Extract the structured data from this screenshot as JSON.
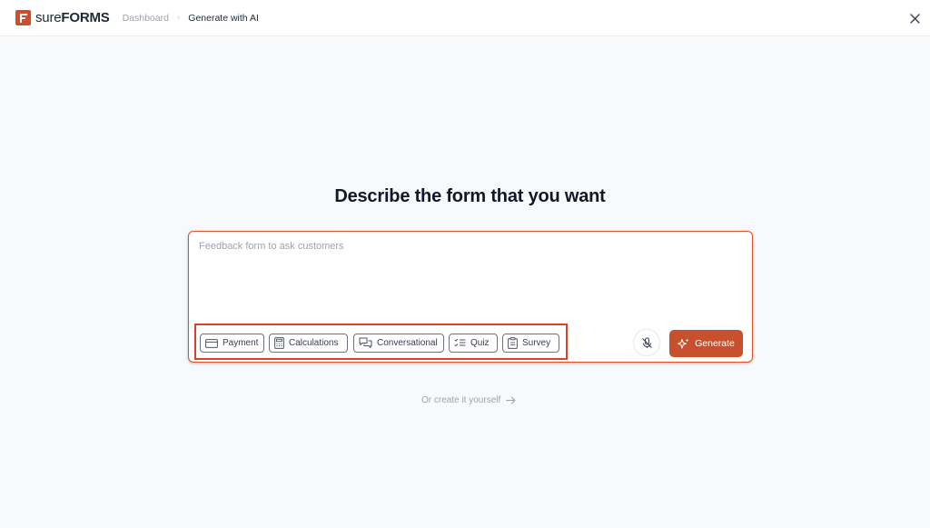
{
  "brand": {
    "name_prefix": "sure",
    "name_suffix": "FORMS",
    "accent_color": "#cf4d2a"
  },
  "breadcrumb": {
    "items": [
      "Dashboard",
      "Generate with AI"
    ],
    "separator": "›"
  },
  "header": {
    "close_icon": "close-icon"
  },
  "main": {
    "title": "Describe the form that you want",
    "prompt": {
      "value": "",
      "placeholder": "Feedback form to ask customers"
    },
    "chips": [
      {
        "label": "Payment",
        "icon": "credit-card-icon"
      },
      {
        "label": "Calculations",
        "icon": "calculator-icon"
      },
      {
        "label": "Conversational",
        "icon": "chat-bubbles-icon"
      },
      {
        "label": "Quiz",
        "icon": "checklist-icon"
      },
      {
        "label": "Survey",
        "icon": "clipboard-icon"
      }
    ],
    "mic_icon": "microphone-off-icon",
    "generate_label": "Generate",
    "create_yourself_label": "Or create it yourself",
    "highlight_color": "#d8432a"
  }
}
